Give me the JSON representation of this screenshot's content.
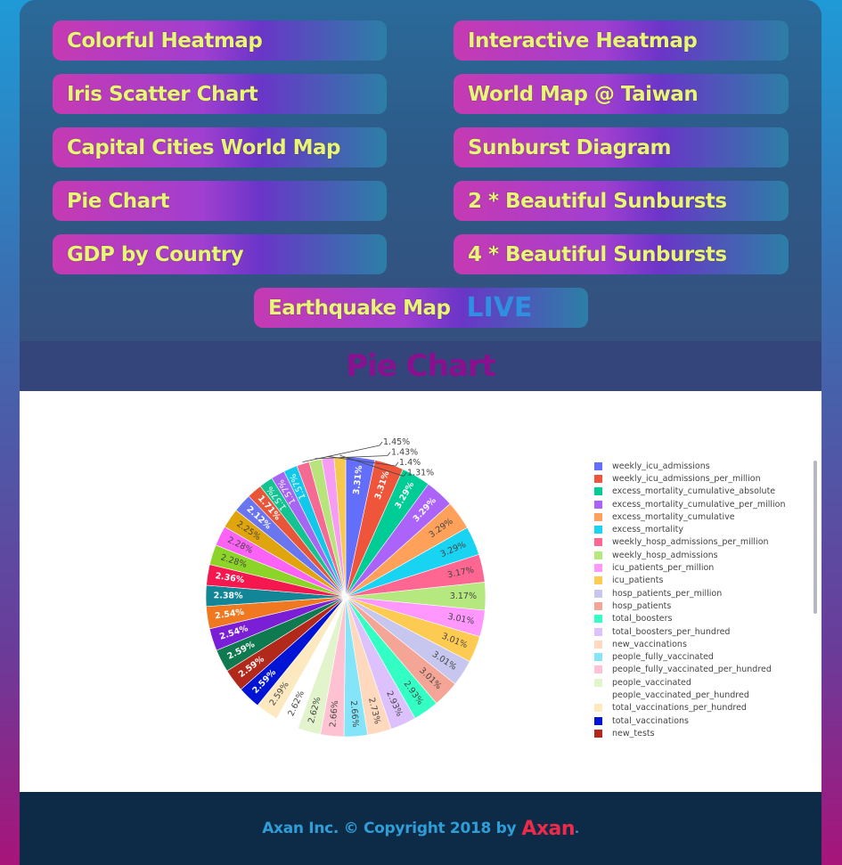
{
  "nav": {
    "colorful_heatmap": "Colorful Heatmap",
    "interactive_heatmap": "Interactive Heatmap",
    "iris_scatter": "Iris Scatter Chart",
    "world_map_taiwan": "World Map @ Taiwan",
    "capital_cities": "Capital Cities World Map",
    "sunburst": "Sunburst Diagram",
    "pie_chart": "Pie Chart",
    "two_sunbursts": "2 * Beautiful Sunbursts",
    "gdp": "GDP by Country",
    "four_sunbursts": "4 * Beautiful Sunbursts",
    "earthquake": "Earthquake Map",
    "live": "LIVE"
  },
  "page_title": "Pie Chart",
  "footer": {
    "text": "Axan Inc. © Copyright 2018 by",
    "brand": "Axan",
    "period": "."
  },
  "chart_data": {
    "type": "pie",
    "title": "",
    "slices": [
      {
        "label": "weekly_icu_admissions",
        "value": 3.31,
        "color": "#636efa"
      },
      {
        "label": "weekly_icu_admissions_per_million",
        "value": 3.31,
        "color": "#ef553b"
      },
      {
        "label": "excess_mortality_cumulative_absolute",
        "value": 3.29,
        "color": "#00cc96"
      },
      {
        "label": "excess_mortality_cumulative_per_million",
        "value": 3.29,
        "color": "#ab63fa"
      },
      {
        "label": "excess_mortality_cumulative",
        "value": 3.29,
        "color": "#ffa15a"
      },
      {
        "label": "excess_mortality",
        "value": 3.29,
        "color": "#19d3f3"
      },
      {
        "label": "weekly_hosp_admissions_per_million",
        "value": 3.17,
        "color": "#ff6692"
      },
      {
        "label": "weekly_hosp_admissions",
        "value": 3.17,
        "color": "#b6e880"
      },
      {
        "label": "icu_patients_per_million",
        "value": 3.01,
        "color": "#ff97ff"
      },
      {
        "label": "icu_patients",
        "value": 3.01,
        "color": "#fecb52"
      },
      {
        "label": "hosp_patients_per_million",
        "value": 3.01,
        "color": "#c6c6ef"
      },
      {
        "label": "hosp_patients",
        "value": 3.01,
        "color": "#f4a596"
      },
      {
        "label": "total_boosters",
        "value": 2.93,
        "color": "#33ffc4"
      },
      {
        "label": "total_boosters_per_hundred",
        "value": 2.93,
        "color": "#dcc1fd"
      },
      {
        "label": "new_vaccinations",
        "value": 2.73,
        "color": "#ffd9bd"
      },
      {
        "label": "people_fully_vaccinated",
        "value": 2.66,
        "color": "#85e5f8"
      },
      {
        "label": "people_fully_vaccinated_per_hundred",
        "value": 2.66,
        "color": "#ffc2d3"
      },
      {
        "label": "people_vaccinated",
        "value": 2.62,
        "color": "#e2f4cc"
      },
      {
        "label": "people_vaccinated_per_hundred",
        "value": 2.62,
        "color": "#ffffff"
      },
      {
        "label": "total_vaccinations_per_hundred",
        "value": 2.59,
        "color": "#fde9c0"
      },
      {
        "label": "total_vaccinations",
        "value": 2.59,
        "color": "#0014d6"
      },
      {
        "label": "new_tests",
        "value": 2.59,
        "color": "#b2291c"
      },
      {
        "label": "",
        "value": 2.59,
        "color": "#0f7a4f"
      },
      {
        "label": "",
        "value": 2.54,
        "color": "#7b1fd6"
      },
      {
        "label": "",
        "value": 2.54,
        "color": "#f07820"
      },
      {
        "label": "",
        "value": 2.38,
        "color": "#128596"
      },
      {
        "label": "",
        "value": 2.36,
        "color": "#f5184f"
      },
      {
        "label": "",
        "value": 2.28,
        "color": "#8dd428"
      },
      {
        "label": "",
        "value": 2.28,
        "color": "#fb62f5"
      },
      {
        "label": "",
        "value": 2.25,
        "color": "#e0a40c"
      },
      {
        "label": "",
        "value": 2.12,
        "color": "#6a76f0"
      },
      {
        "label": "",
        "value": 1.71,
        "color": "#e8563a"
      },
      {
        "label": "",
        "value": 1.57,
        "color": "#14c490"
      },
      {
        "label": "",
        "value": 1.57,
        "color": "#a765f2"
      },
      {
        "label": "",
        "value": 1.57,
        "color": "#12c8ea"
      },
      {
        "label": "",
        "value": 1.45,
        "color": "#f56a92"
      },
      {
        "label": "",
        "value": 1.43,
        "color": "#b8e47c"
      },
      {
        "label": "",
        "value": 1.4,
        "color": "#f79cf5"
      },
      {
        "label": "",
        "value": 1.31,
        "color": "#f7c84e"
      }
    ],
    "legend_placement": "right"
  }
}
